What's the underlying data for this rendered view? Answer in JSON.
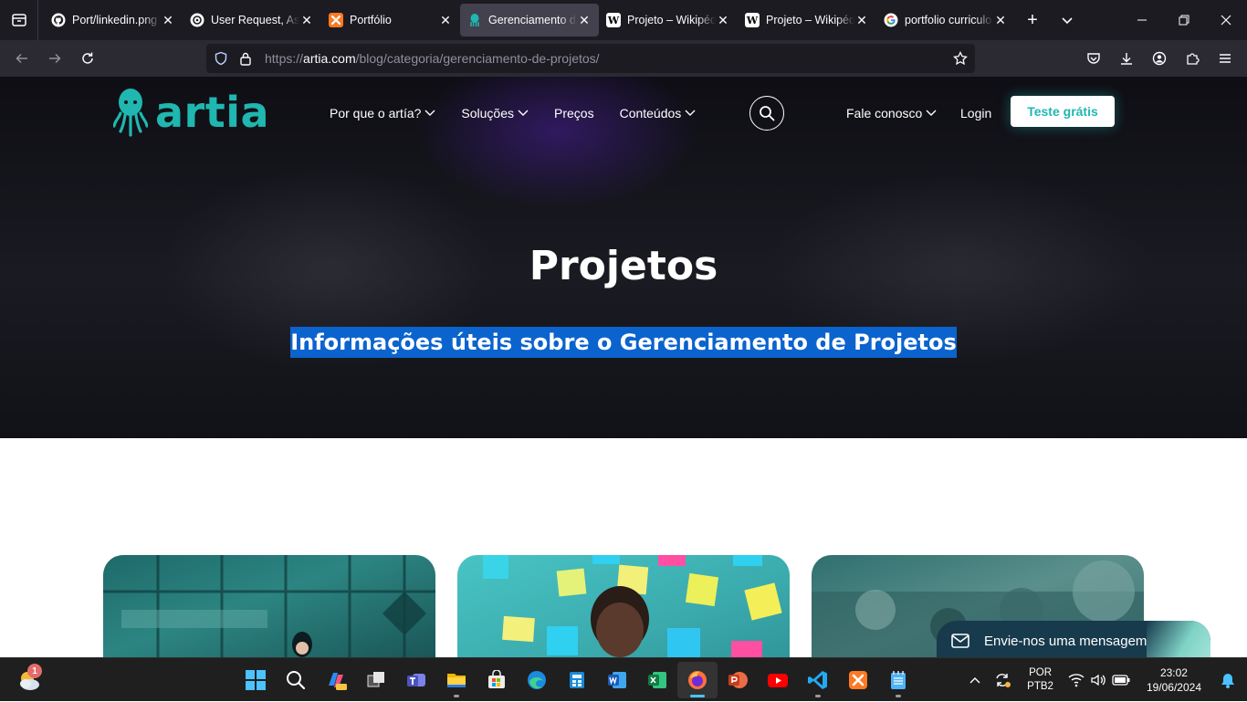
{
  "browser": {
    "tabs": [
      {
        "title": "Port/linkedin.png",
        "icon": "github-icon",
        "active": false
      },
      {
        "title": "User Request, Assi",
        "icon": "openai-icon",
        "active": false
      },
      {
        "title": "Portfólio",
        "icon": "xampp-icon",
        "active": false
      },
      {
        "title": "Gerenciamento de",
        "icon": "artia-icon",
        "active": true
      },
      {
        "title": "Projeto – Wikipédi",
        "icon": "wikipedia-icon",
        "active": false
      },
      {
        "title": "Projeto – Wikipédi",
        "icon": "wikipedia-icon",
        "active": false
      },
      {
        "title": "portfolio curriculo",
        "icon": "google-icon",
        "active": false
      }
    ],
    "wiki_letter": "W",
    "url_prefix": "https://",
    "url_host": "artia.com",
    "url_path": "/blog/categoria/gerenciamento-de-projetos/"
  },
  "site": {
    "logo_text": "artia",
    "brand_color": "#1fb7b0",
    "menu": [
      {
        "label": "Por que o artía?",
        "has_dropdown": true
      },
      {
        "label": "Soluções",
        "has_dropdown": true
      },
      {
        "label": "Preços",
        "has_dropdown": false
      },
      {
        "label": "Conteúdos",
        "has_dropdown": true
      }
    ],
    "contact_label": "Fale conosco",
    "login_label": "Login",
    "cta_label": "Teste grátis",
    "hero_title": "Projetos",
    "hero_subtitle": "Informações úteis sobre o Gerenciamento de Projetos",
    "chat_label": "Envie-nos uma mensagem"
  },
  "taskbar": {
    "notification_count": "1",
    "lang_line1": "POR",
    "lang_line2": "PTB2",
    "time": "23:02",
    "date": "19/06/2024"
  }
}
